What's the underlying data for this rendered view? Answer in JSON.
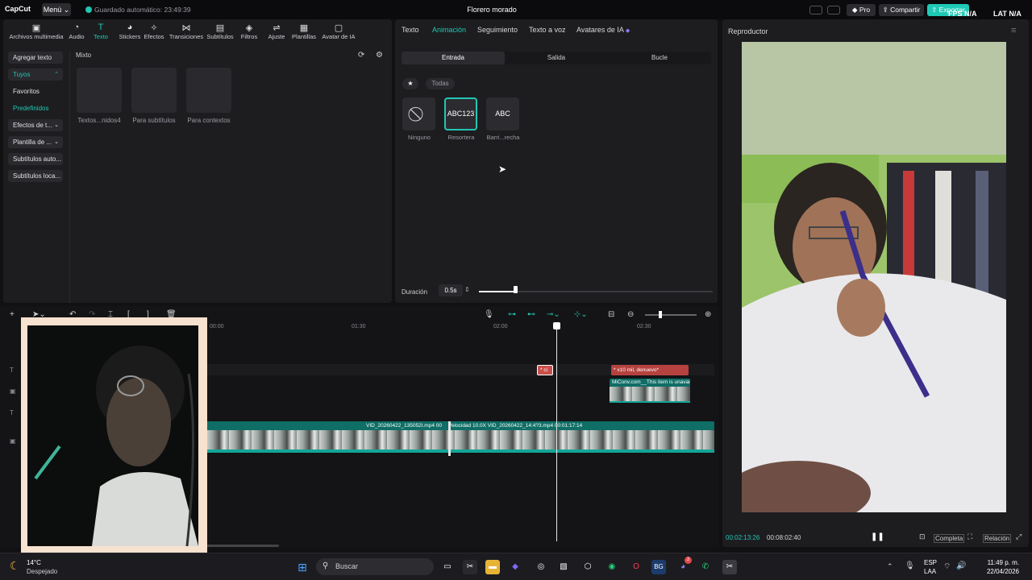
{
  "app": {
    "logo": "CapCut",
    "menu": "Menú",
    "autosave": "Guardado automático: 23:49:39",
    "title": "Florero morado",
    "pro": "Pro",
    "share": "Compartir",
    "export": "Exportar",
    "fps": "FPS N/A",
    "lat": "LAT N/A"
  },
  "toolbar": [
    {
      "label": "Archivos multimedia",
      "icon": "▣"
    },
    {
      "label": "Audio",
      "icon": "◔"
    },
    {
      "label": "Texto",
      "icon": "T"
    },
    {
      "label": "Stickers",
      "icon": "◕"
    },
    {
      "label": "Efectos",
      "icon": "✧"
    },
    {
      "label": "Transiciones",
      "icon": "⋈"
    },
    {
      "label": "Subtítulos",
      "icon": "▤"
    },
    {
      "label": "Filtros",
      "icon": "◈"
    },
    {
      "label": "Ajuste",
      "icon": "⇌"
    },
    {
      "label": "Plantillas",
      "icon": "▦"
    },
    {
      "label": "Avatar de IA",
      "icon": "▢"
    }
  ],
  "sidebar": [
    {
      "label": "Agregar texto"
    },
    {
      "label": "Tuyos",
      "caret": "⌃"
    },
    {
      "label": "Favoritos"
    },
    {
      "label": "Predefinidos"
    },
    {
      "label": "Efectos de t...",
      "caret": "⌄"
    },
    {
      "label": "Plantilla de ...",
      "caret": "⌄"
    },
    {
      "label": "Subtítulos auto..."
    },
    {
      "label": "Subtítulos loca..."
    }
  ],
  "library": {
    "section": "Mixto",
    "cards": [
      "Textos...nidos4",
      "Para subtítulos",
      "Para contextos"
    ]
  },
  "anim": {
    "tabs": [
      "Texto",
      "Animación",
      "Seguimiento",
      "Texto a voz",
      "Avatares de IA"
    ],
    "segments": [
      "Entrada",
      "Salida",
      "Bucle"
    ],
    "filter_all": "Todas",
    "presets": [
      {
        "thumb": "⃠",
        "label": "Ninguno"
      },
      {
        "thumb": "ABC123",
        "label": "Resortera"
      },
      {
        "thumb": "ABC",
        "label": "Barri...recha"
      }
    ],
    "duration_label": "Duración",
    "duration_value": "0.5s",
    "duration_fraction": 0.16
  },
  "player": {
    "label": "Reproductor",
    "current": "00:02:13:26",
    "total": "00:08:02:40",
    "full": "Completa",
    "ratio": "Relación"
  },
  "timeline": {
    "ticks": [
      "00:00",
      "01:30",
      "02:00",
      "02:30"
    ],
    "text_clip_1": "* ci",
    "text_clip_2": "* x10 mil, denuevo*",
    "overlay_clip": "MiConv.com__This item is unavailable",
    "main_clip_a": "VID_20260422_135052I.mp4   00",
    "main_clip_b": "Velocidad 10.0X   VID_20260422_14:4?3.mp4   00:01:17:14"
  },
  "taskbar": {
    "weather_temp": "14°C",
    "weather_desc": "Despejado",
    "search": "Buscar",
    "lang": "ESP",
    "lang2": "LAA",
    "time": "11:49 p. m.",
    "date": "22/04/2026",
    "badge": "2"
  }
}
